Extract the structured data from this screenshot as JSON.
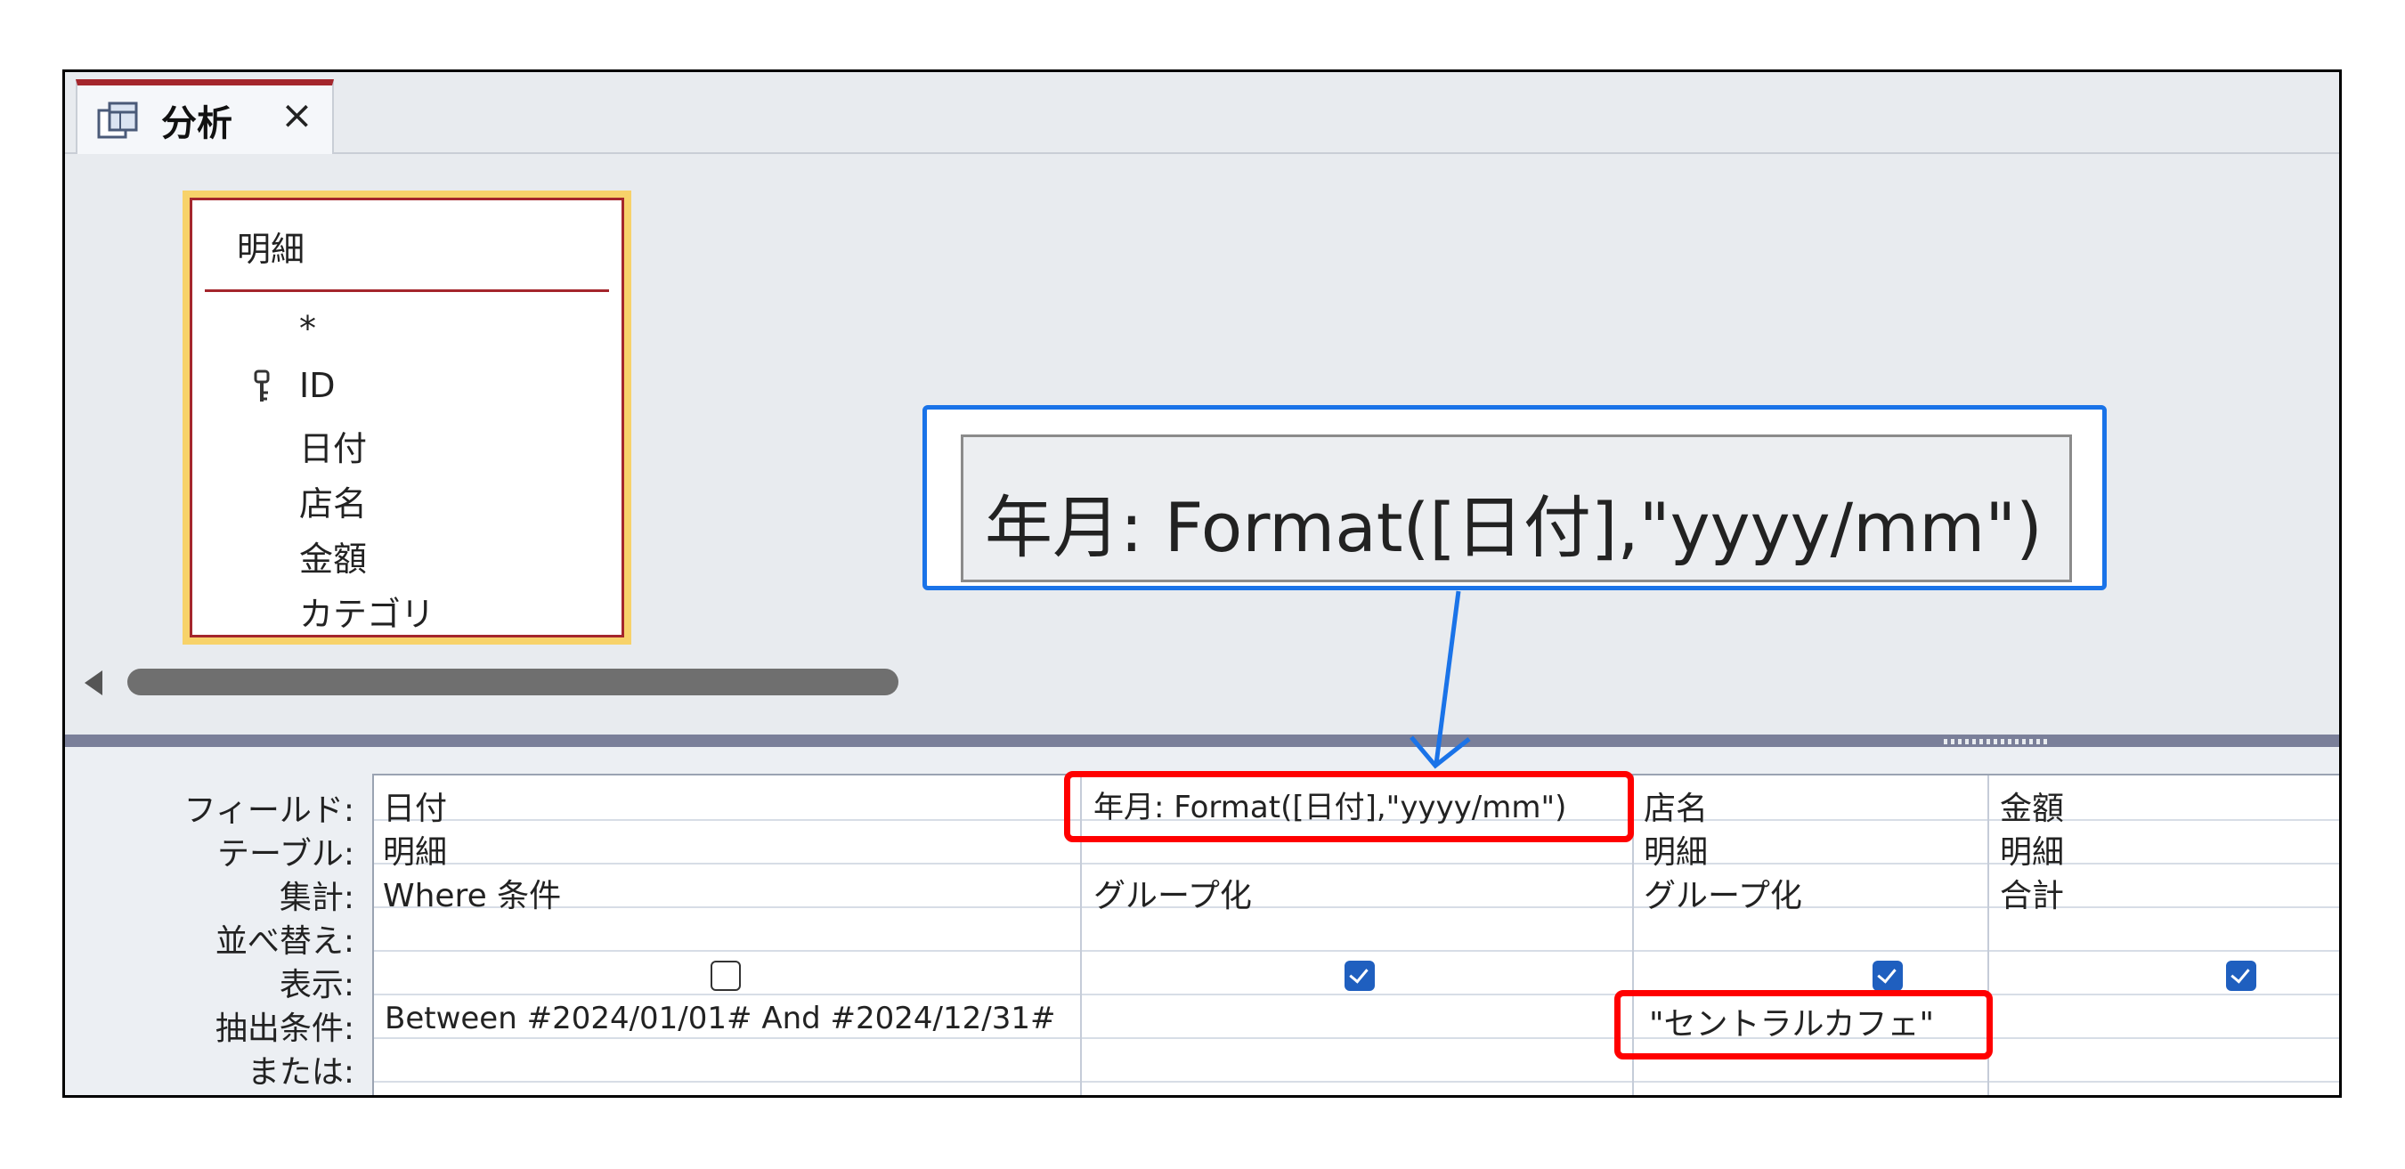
{
  "tab": {
    "title": "分析",
    "close_glyph": "×"
  },
  "field_list": {
    "table_name": "明細",
    "fields": [
      "*",
      "ID",
      "日付",
      "店名",
      "金額",
      "カテゴリ"
    ]
  },
  "grid": {
    "row_labels": [
      "フィールド:",
      "テーブル:",
      "集計:",
      "並べ替え:",
      "表示:",
      "抽出条件:",
      "または:"
    ],
    "columns": [
      {
        "field": "日付",
        "table": "明細",
        "total": "Where 条件",
        "sort": "",
        "show": false,
        "criteria": "Between #2024/01/01# And #2024/12/31#",
        "or": ""
      },
      {
        "field": "年月: Format([日付],\"yyyy/mm\")",
        "table": "",
        "total": "グループ化",
        "sort": "",
        "show": true,
        "criteria": "",
        "or": ""
      },
      {
        "field": "店名",
        "table": "明細",
        "total": "グループ化",
        "sort": "",
        "show": true,
        "criteria": "\"セントラルカフェ\"",
        "or": ""
      },
      {
        "field": "金額",
        "table": "明細",
        "total": "合計",
        "sort": "",
        "show": true,
        "criteria": "",
        "or": ""
      }
    ]
  },
  "zoom_callout": {
    "text": "年月: Format([日付],\"yyyy/mm\")"
  },
  "colors": {
    "accent_red": "#ff0000",
    "callout_blue": "#1a73e8",
    "tab_accent": "#a4262c",
    "checkbox_blue": "#1f5fbf"
  },
  "icons": [
    "query-icon",
    "close-icon",
    "primary-key-icon",
    "scroll-left-icon"
  ]
}
